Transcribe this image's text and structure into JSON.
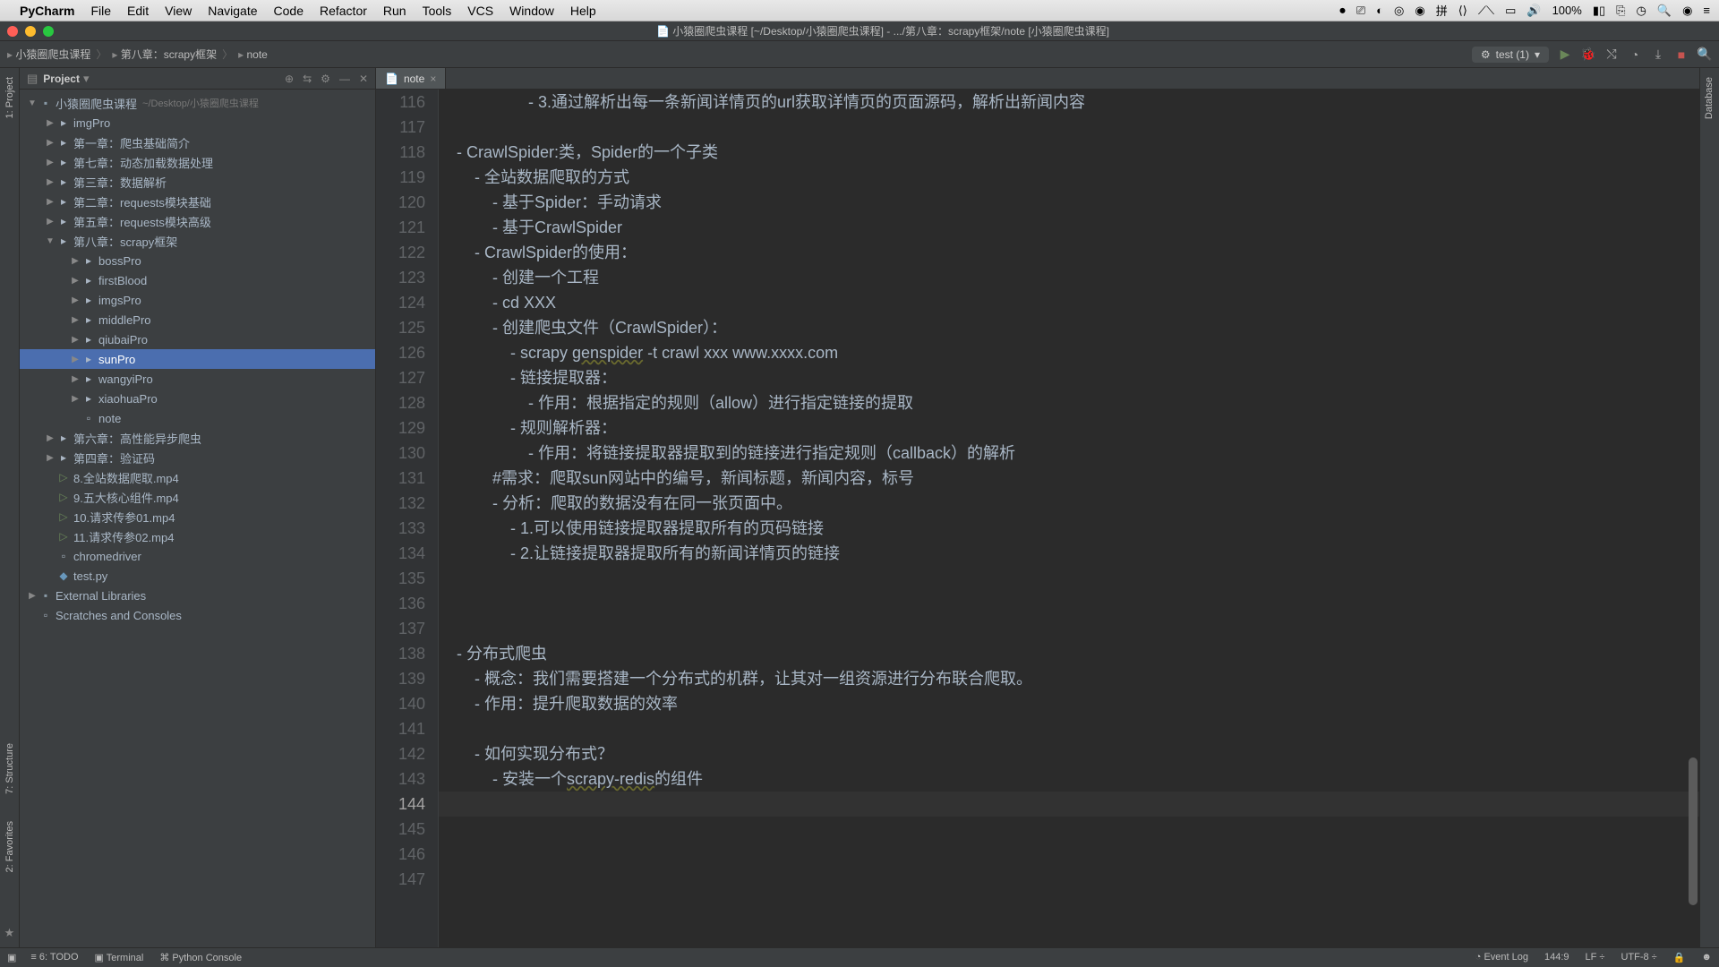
{
  "menubar": {
    "app": "PyCharm",
    "items": [
      "File",
      "Edit",
      "View",
      "Navigate",
      "Code",
      "Refactor",
      "Run",
      "Tools",
      "VCS",
      "Window",
      "Help"
    ],
    "battery": "100%",
    "input_method": "拼"
  },
  "titlebar": {
    "title": "小猿圈爬虫课程 [~/Desktop/小猿圈爬虫课程] - .../第八章：scrapy框架/note [小猿圈爬虫课程]"
  },
  "breadcrumb": [
    "小猿圈爬虫课程",
    "第八章：scrapy框架",
    "note"
  ],
  "run_config": "test (1)",
  "project_panel": {
    "label": "Project"
  },
  "left_rail": [
    "1: Project",
    "7: Structure",
    "2: Favorites"
  ],
  "right_rail": "Database",
  "tree": [
    {
      "d": 0,
      "tw": "▼",
      "ic": "root",
      "label": "小猿圈爬虫课程",
      "path": "~/Desktop/小猿圈爬虫课程"
    },
    {
      "d": 1,
      "tw": "▶",
      "ic": "folder",
      "label": "imgPro"
    },
    {
      "d": 1,
      "tw": "▶",
      "ic": "folder",
      "label": "第一章：爬虫基础简介"
    },
    {
      "d": 1,
      "tw": "▶",
      "ic": "folder",
      "label": "第七章：动态加载数据处理"
    },
    {
      "d": 1,
      "tw": "▶",
      "ic": "folder",
      "label": "第三章：数据解析"
    },
    {
      "d": 1,
      "tw": "▶",
      "ic": "folder",
      "label": "第二章：requests模块基础"
    },
    {
      "d": 1,
      "tw": "▶",
      "ic": "folder",
      "label": "第五章：requests模块高级"
    },
    {
      "d": 1,
      "tw": "▼",
      "ic": "folder",
      "label": "第八章：scrapy框架"
    },
    {
      "d": 2,
      "tw": "▶",
      "ic": "folder",
      "label": "bossPro"
    },
    {
      "d": 2,
      "tw": "▶",
      "ic": "folder",
      "label": "firstBlood"
    },
    {
      "d": 2,
      "tw": "▶",
      "ic": "folder",
      "label": "imgsPro"
    },
    {
      "d": 2,
      "tw": "▶",
      "ic": "folder",
      "label": "middlePro"
    },
    {
      "d": 2,
      "tw": "▶",
      "ic": "folder",
      "label": "qiubaiPro"
    },
    {
      "d": 2,
      "tw": "▶",
      "ic": "folder",
      "label": "sunPro",
      "selected": true
    },
    {
      "d": 2,
      "tw": "▶",
      "ic": "folder",
      "label": "wangyiPro"
    },
    {
      "d": 2,
      "tw": "▶",
      "ic": "folder",
      "label": "xiaohuaPro"
    },
    {
      "d": 2,
      "tw": "",
      "ic": "file",
      "label": "note"
    },
    {
      "d": 1,
      "tw": "▶",
      "ic": "folder",
      "label": "第六章：高性能异步爬虫"
    },
    {
      "d": 1,
      "tw": "▶",
      "ic": "folder",
      "label": "第四章：验证码"
    },
    {
      "d": 1,
      "tw": "",
      "ic": "media",
      "label": "8.全站数据爬取.mp4"
    },
    {
      "d": 1,
      "tw": "",
      "ic": "media",
      "label": "9.五大核心组件.mp4"
    },
    {
      "d": 1,
      "tw": "",
      "ic": "media",
      "label": "10.请求传参01.mp4"
    },
    {
      "d": 1,
      "tw": "",
      "ic": "media",
      "label": "11.请求传参02.mp4"
    },
    {
      "d": 1,
      "tw": "",
      "ic": "file",
      "label": "chromedriver"
    },
    {
      "d": 1,
      "tw": "",
      "ic": "py",
      "label": "test.py"
    },
    {
      "d": 0,
      "tw": "▶",
      "ic": "root",
      "label": "External Libraries"
    },
    {
      "d": 0,
      "tw": "",
      "ic": "file",
      "label": "Scratches and Consoles"
    }
  ],
  "editor": {
    "tab": "note",
    "first_line": 116,
    "lines": [
      "                - 3.通过解析出每一条新闻详情页的url获取详情页的页面源码，解析出新闻内容",
      "",
      "- CrawlSpider:类，Spider的一个子类",
      "    - 全站数据爬取的方式",
      "        - 基于Spider：手动请求",
      "        - 基于CrawlSpider",
      "    - CrawlSpider的使用：",
      "        - 创建一个工程",
      "        - cd XXX",
      "        - 创建爬虫文件（CrawlSpider）：",
      "            - scrapy genspider -t crawl xxx www.xxxx.com",
      "            - 链接提取器：",
      "                - 作用：根据指定的规则（allow）进行指定链接的提取",
      "            - 规则解析器：",
      "                - 作用：将链接提取器提取到的链接进行指定规则（callback）的解析",
      "        #需求：爬取sun网站中的编号，新闻标题，新闻内容，标号",
      "        - 分析：爬取的数据没有在同一张页面中。",
      "            - 1.可以使用链接提取器提取所有的页码链接",
      "            - 2.让链接提取器提取所有的新闻详情页的链接",
      "",
      "",
      "",
      "- 分布式爬虫",
      "    - 概念：我们需要搭建一个分布式的机群，让其对一组资源进行分布联合爬取。",
      "    - 作用：提升爬取数据的效率",
      "",
      "    - 如何实现分布式？",
      "        - 安装一个scrapy-redis的组件",
      "        ",
      "",
      "",
      ""
    ],
    "current_line": 144,
    "wavy_words": [
      "genspider",
      "scrapy-redis"
    ]
  },
  "statusbar": {
    "todo": "6: TODO",
    "terminal": "Terminal",
    "console": "Python Console",
    "event_log": "Event Log",
    "position": "144:9",
    "line_sep": "LF",
    "encoding": "UTF-8"
  }
}
